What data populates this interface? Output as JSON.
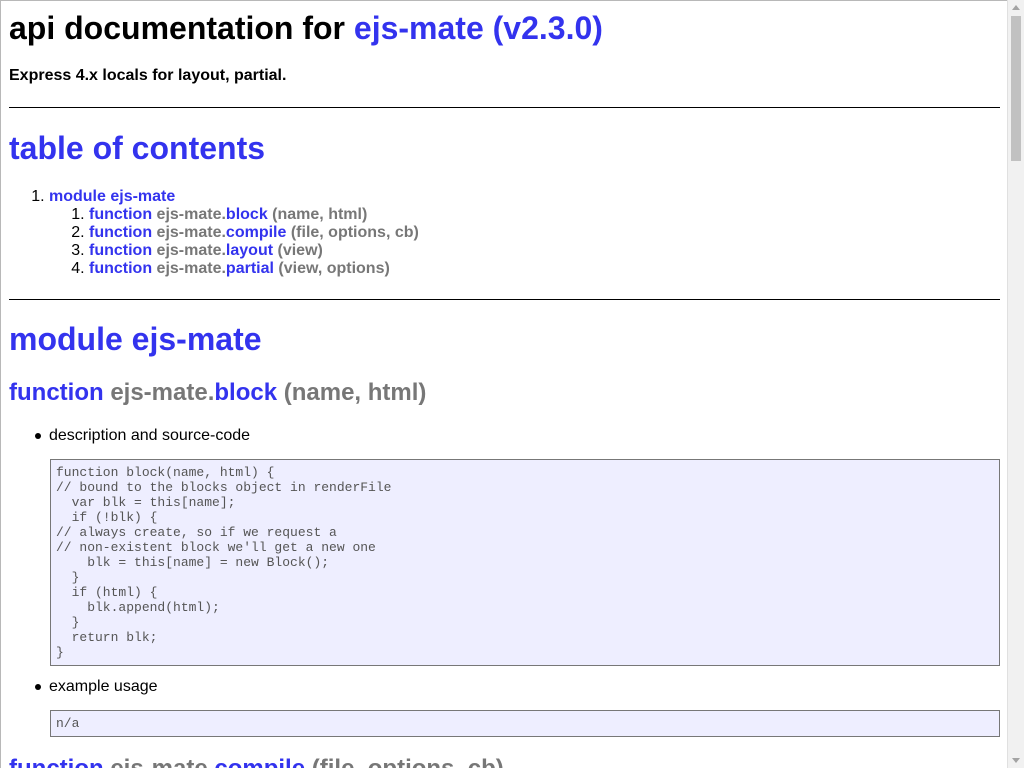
{
  "header": {
    "title_prefix": "api documentation for ",
    "title_link": "ejs-mate (v2.3.0)",
    "subtitle": "Express 4.x locals for layout, partial."
  },
  "toc": {
    "heading": "table of contents",
    "module_item": {
      "keyword": "module",
      "name": "ejs-mate"
    },
    "functions": [
      {
        "keyword": "function",
        "prefix": "ejs-mate.",
        "name": "block",
        "params": "(name, html)"
      },
      {
        "keyword": "function",
        "prefix": "ejs-mate.",
        "name": "compile",
        "params": "(file, options, cb)"
      },
      {
        "keyword": "function",
        "prefix": "ejs-mate.",
        "name": "layout",
        "params": "(view)"
      },
      {
        "keyword": "function",
        "prefix": "ejs-mate.",
        "name": "partial",
        "params": "(view, options)"
      }
    ]
  },
  "module_section": {
    "heading": "module ejs-mate",
    "fn_block": {
      "keyword": "function",
      "prefix": "ejs-mate.",
      "name": "block",
      "params": "(name, html)",
      "desc_label": "description and source-code",
      "source": "function block(name, html) {\n// bound to the blocks object in renderFile\n  var blk = this[name];\n  if (!blk) {\n// always create, so if we request a\n// non-existent block we'll get a new one\n    blk = this[name] = new Block();\n  }\n  if (html) {\n    blk.append(html);\n  }\n  return blk;\n}",
      "example_label": "example usage",
      "example": "n/a"
    },
    "fn_compile": {
      "keyword": "function",
      "prefix": "ejs-mate.",
      "name": "compile",
      "params": "(file, options, cb)"
    }
  },
  "colors": {
    "link": "#3333ee",
    "muted": "#777777",
    "code_bg": "#eeeeff"
  }
}
